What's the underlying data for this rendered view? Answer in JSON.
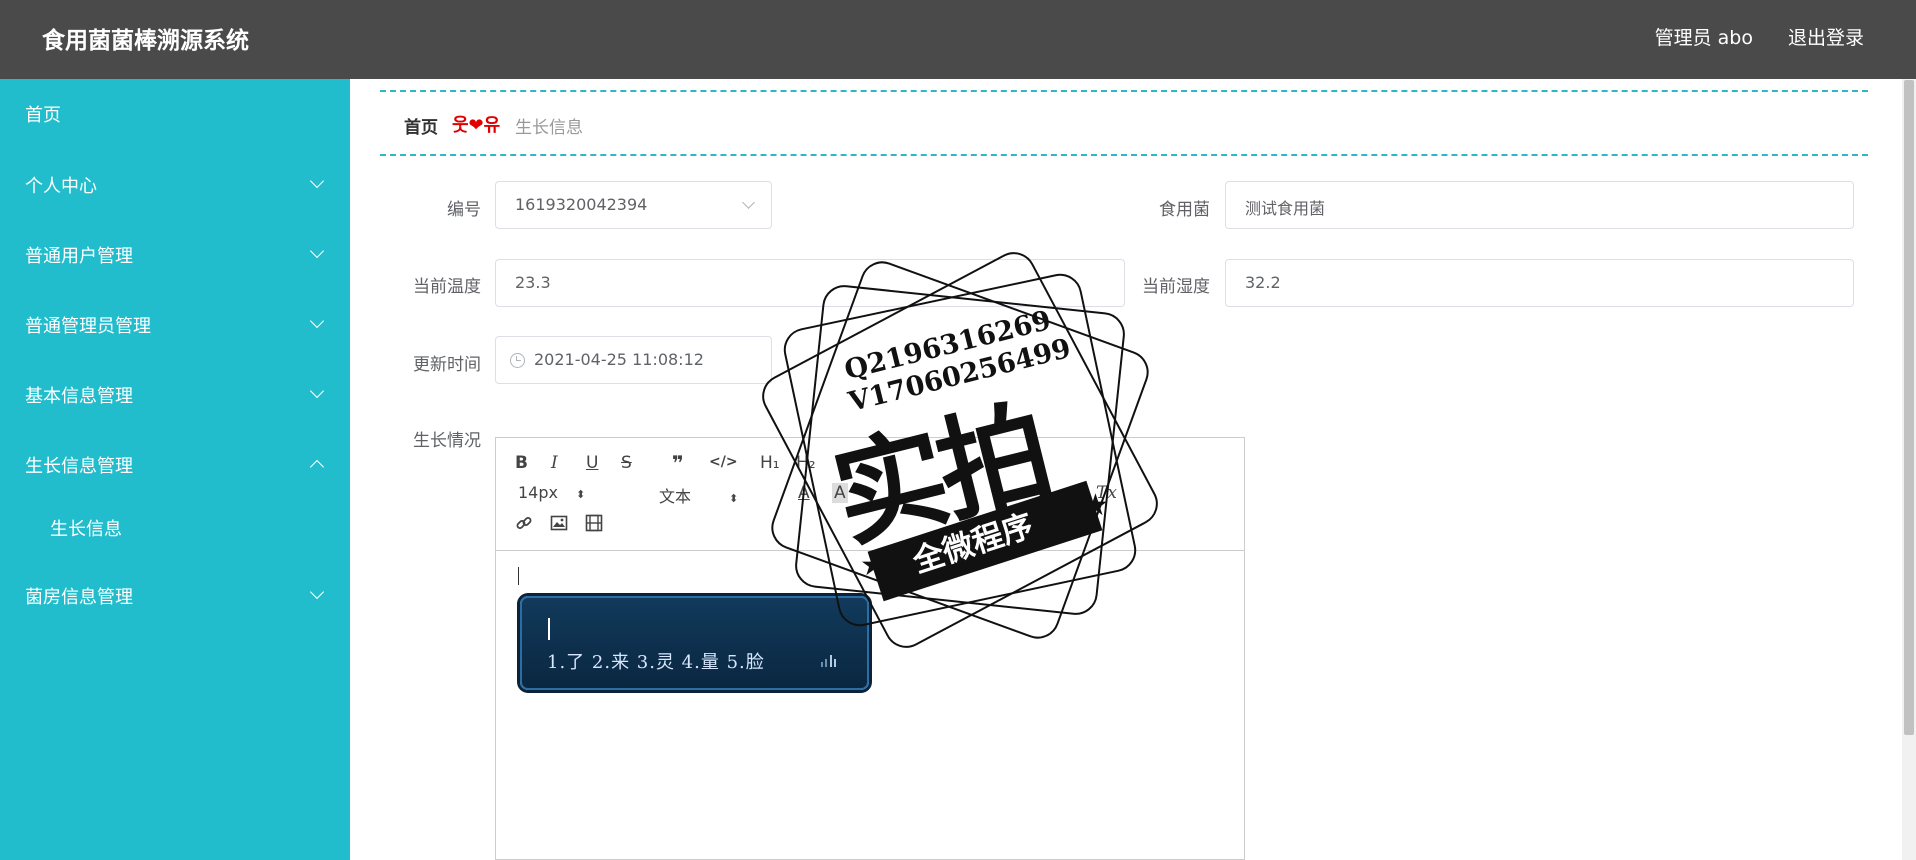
{
  "header": {
    "title": "食用菌菌棒溯源系统",
    "user": "管理员 abo",
    "logout": "退出登录"
  },
  "sidebar": {
    "items": [
      {
        "label": "首页"
      },
      {
        "label": "个人中心"
      },
      {
        "label": "普通用户管理"
      },
      {
        "label": "普通管理员管理"
      },
      {
        "label": "基本信息管理"
      },
      {
        "label": "生长信息管理"
      },
      {
        "label": "生长信息"
      },
      {
        "label": "菌房信息管理"
      }
    ]
  },
  "breadcrumb": {
    "home": "首页",
    "separator": "웃❤유",
    "current": "生长信息"
  },
  "form": {
    "id_label": "编号",
    "id_value": "1619320042394",
    "fungus_label": "食用菌",
    "fungus_value": "测试食用菌",
    "temp_label": "当前温度",
    "temp_value": "23.3",
    "humidity_label": "当前湿度",
    "humidity_value": "32.2",
    "time_label": "更新时间",
    "time_value": "2021-04-25 11:08:12",
    "growth_label": "生长情况"
  },
  "editor": {
    "bold": "B",
    "italic": "I",
    "underline": "U",
    "strike": "S",
    "quote": "❞",
    "code": "</>",
    "h1": "H₁",
    "h2": "H₂",
    "size": "14px",
    "header_select": "文本",
    "color_icon": "A",
    "bg_icon": "A",
    "clear_icon": "Tx"
  },
  "ime": {
    "candidates": "1.了 2.来 3.灵 4.量 5.脸"
  },
  "stamp": {
    "line1": "Q2196316269",
    "line2": "V17060256499",
    "big": "实拍",
    "ribbon": "全微程序"
  }
}
